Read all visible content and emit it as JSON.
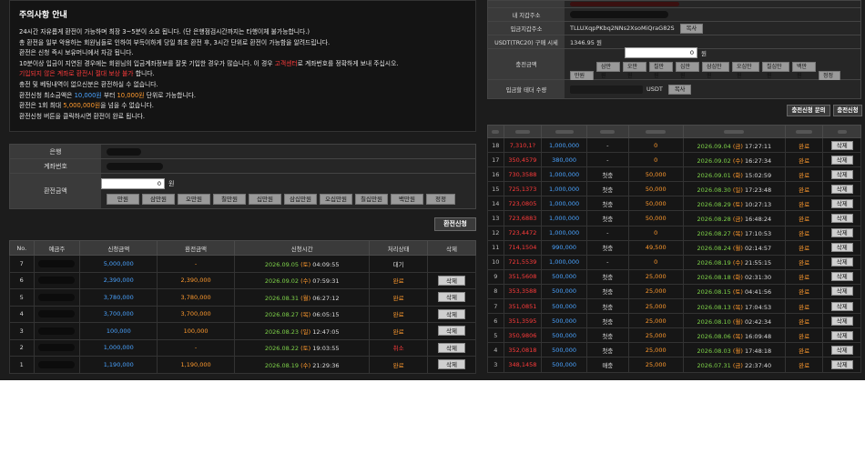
{
  "notice": {
    "title": "주의사항 안내",
    "lines": [
      {
        "text": "24시간 자유롭게 환전이 가능하며 최장 3~5분이 소요 됩니다. (단 은행점검시간까지는 타행이체 불가능합니다.)",
        "color": "default"
      },
      {
        "text": "총 환전을 일부 악용하는 회원님들로 인하여 부득이하게 당일 최초 환전 후, 3시간 단위로 환전이 가능함을 알려드립니다.",
        "color": "default"
      },
      {
        "text": "환전은 신청 즉시 보유머니에서 차감 됩니다.",
        "color": "default"
      },
      {
        "text": "10분이상 입금이 지연된 경우에는 회원님의 입금계좌정보를 잘못 기입한 경우가 많습니다. 이 경우 고객센터로 계좌번호를 정확하게 보내 주십시오.",
        "color": "mixed"
      },
      {
        "text": "기입되지 않은 계좌로 환전시 절대 보상 불가",
        "color": "red"
      },
      {
        "text": "충전 및 베팅내역이 없으신분은 환전하실 수 없습니다.",
        "color": "default"
      },
      {
        "text": "환전신청 최소금액은 10,000원 부터 10,000원 단위로 가능합니다.",
        "color": "mixed2"
      },
      {
        "text": "환전은 1회 최대 5,000,000원을 넘을 수 없습니다.",
        "color": "mixed3"
      },
      {
        "text": "환전신청 버튼을 클릭하시면 환전이 완료 됩니다.",
        "color": "default"
      }
    ],
    "line4_pre": "10분이상 입금이 지연된 경우에는 회원님의 입금계좌정보를 잘못 기입한 경우가 많습니다. 이 경우 ",
    "line4_red": "고객센터",
    "line4_post": "로 계좌번호를 정확하게 보내 주십시오.",
    "line7_pre": "환전신청 최소금액은 ",
    "line7_a": "10,000원",
    "line7_mid": " 부터 ",
    "line7_b": "10,000원",
    "line7_post": " 단위로 가능합니다.",
    "line8_pre": "환전은 1회 최대 ",
    "line8_a": "5,000,000원",
    "line8_post": "을 넘을 수 없습니다.",
    "line5_red": "기입되지 않은 계좌로 환전시 절대 보상 불가",
    "line5_post": " 합니다."
  },
  "withdraw_form": {
    "bank_label": "은행",
    "account_label": "계좌번호",
    "amount_label": "환전금액",
    "amount_value": "0",
    "unit": "원",
    "chips": [
      "만원",
      "삼만원",
      "오만원",
      "칠만원",
      "십만원",
      "삼십만원",
      "오십만원",
      "칠십만원",
      "백만원",
      "정정"
    ],
    "submit_label": "환전신청"
  },
  "withdraw_table": {
    "headers": [
      "No.",
      "예금주",
      "신청금액",
      "환전금액",
      "신청시간",
      "처리상태",
      "삭제"
    ],
    "rows": [
      {
        "no": "7",
        "amount": "5,000,000",
        "exchanged": "-",
        "date": "2026.09.05",
        "day": "(토)",
        "time": "04:09:55",
        "status": "대기",
        "status_color": "white",
        "del": ""
      },
      {
        "no": "6",
        "amount": "2,390,000",
        "exchanged": "2,390,000",
        "date": "2026.09.02",
        "day": "(수)",
        "time": "07:59:31",
        "status": "완료",
        "status_color": "orange",
        "del": "삭제"
      },
      {
        "no": "5",
        "amount": "3,780,000",
        "exchanged": "3,780,000",
        "date": "2026.08.31",
        "day": "(월)",
        "time": "06:27:12",
        "status": "완료",
        "status_color": "orange",
        "del": "삭제"
      },
      {
        "no": "4",
        "amount": "3,700,000",
        "exchanged": "3,700,000",
        "date": "2026.08.27",
        "day": "(목)",
        "time": "06:05:15",
        "status": "완료",
        "status_color": "orange",
        "del": "삭제"
      },
      {
        "no": "3",
        "amount": "100,000",
        "exchanged": "100,000",
        "date": "2026.08.23",
        "day": "(일)",
        "time": "12:47:05",
        "status": "완료",
        "status_color": "orange",
        "del": "삭제"
      },
      {
        "no": "2",
        "amount": "1,000,000",
        "exchanged": "-",
        "date": "2026.08.22",
        "day": "(토)",
        "time": "19:03:55",
        "status": "취소",
        "status_color": "red",
        "del": "삭제"
      },
      {
        "no": "1",
        "amount": "1,190,000",
        "exchanged": "1,190,000",
        "date": "2026.08.19",
        "day": "(수)",
        "time": "21:29:36",
        "status": "완료",
        "status_color": "orange",
        "del": "삭제"
      }
    ]
  },
  "deposit_form": {
    "rows": [
      {
        "label": "",
        "value": ""
      },
      {
        "label": "내 지갑주소",
        "value": ""
      },
      {
        "label": "입금지갑주소",
        "value": "TLLUXqpPKbq2NNs2XsoMiQraG82S",
        "copy": "복사"
      },
      {
        "label": "USDT(TRC20) 구매 시세",
        "value": "1346.95 원"
      }
    ],
    "amount_label": "충전금액",
    "amount_value": "0",
    "unit": "원",
    "chips": [
      "만원",
      "삼만원",
      "오만원",
      "칠만원",
      "십만원",
      "삼십만원",
      "오십만원",
      "칠십만원",
      "백만원",
      "정정"
    ],
    "usdt_label": "입금할 테더 수량",
    "usdt_unit": "USDT",
    "usdt_copy": "복사",
    "btn_apply": "충전신청 문의",
    "btn_submit": "충전신청"
  },
  "deposit_table": {
    "headers": [
      "",
      "",
      "",
      "",
      "",
      "",
      "",
      ""
    ],
    "rows": [
      {
        "no": "18",
        "val": "7,310,1?",
        "amount": "1,000,000",
        "event": "-",
        "bonus": "0",
        "date": "2026.09.04",
        "day": "(금)",
        "time": "17:27:11",
        "status": "완료",
        "del": "삭제"
      },
      {
        "no": "17",
        "val": "350,4579",
        "amount": "380,000",
        "event": "-",
        "bonus": "0",
        "date": "2026.09.02",
        "day": "(수)",
        "time": "16:27:34",
        "status": "완료",
        "del": "삭제"
      },
      {
        "no": "16",
        "val": "730,3588",
        "amount": "1,000,000",
        "event": "첫충",
        "bonus": "50,000",
        "date": "2026.09.01",
        "day": "(화)",
        "time": "15:02:59",
        "status": "완료",
        "del": "삭제"
      },
      {
        "no": "15",
        "val": "725,1373",
        "amount": "1,000,000",
        "event": "첫충",
        "bonus": "50,000",
        "date": "2026.08.30",
        "day": "(일)",
        "time": "17:23:48",
        "status": "완료",
        "del": "삭제"
      },
      {
        "no": "14",
        "val": "723,0805",
        "amount": "1,000,000",
        "event": "첫충",
        "bonus": "50,000",
        "date": "2026.08.29",
        "day": "(토)",
        "time": "10:27:13",
        "status": "완료",
        "del": "삭제"
      },
      {
        "no": "13",
        "val": "723,6883",
        "amount": "1,000,000",
        "event": "첫충",
        "bonus": "50,000",
        "date": "2026.08.28",
        "day": "(금)",
        "time": "16:48:24",
        "status": "완료",
        "del": "삭제"
      },
      {
        "no": "12",
        "val": "723,4472",
        "amount": "1,000,000",
        "event": "-",
        "bonus": "0",
        "date": "2026.08.27",
        "day": "(목)",
        "time": "17:10:53",
        "status": "완료",
        "del": "삭제"
      },
      {
        "no": "11",
        "val": "714,1504",
        "amount": "990,000",
        "event": "첫충",
        "bonus": "49,500",
        "date": "2026.08.24",
        "day": "(월)",
        "time": "02:14:57",
        "status": "완료",
        "del": "삭제"
      },
      {
        "no": "10",
        "val": "721,5539",
        "amount": "1,000,000",
        "event": "-",
        "bonus": "0",
        "date": "2026.08.19",
        "day": "(수)",
        "time": "21:55:15",
        "status": "완료",
        "del": "삭제"
      },
      {
        "no": "9",
        "val": "351,5608",
        "amount": "500,000",
        "event": "첫충",
        "bonus": "25,000",
        "date": "2026.08.18",
        "day": "(화)",
        "time": "02:31:30",
        "status": "완료",
        "del": "삭제"
      },
      {
        "no": "8",
        "val": "353,3588",
        "amount": "500,000",
        "event": "첫충",
        "bonus": "25,000",
        "date": "2026.08.15",
        "day": "(토)",
        "time": "04:41:56",
        "status": "완료",
        "del": "삭제"
      },
      {
        "no": "7",
        "val": "351,0851",
        "amount": "500,000",
        "event": "첫충",
        "bonus": "25,000",
        "date": "2026.08.13",
        "day": "(목)",
        "time": "17:04:53",
        "status": "완료",
        "del": "삭제"
      },
      {
        "no": "6",
        "val": "351,3595",
        "amount": "500,000",
        "event": "첫충",
        "bonus": "25,000",
        "date": "2026.08.10",
        "day": "(월)",
        "time": "02:42:34",
        "status": "완료",
        "del": "삭제"
      },
      {
        "no": "5",
        "val": "350,9806",
        "amount": "500,000",
        "event": "첫충",
        "bonus": "25,000",
        "date": "2026.08.06",
        "day": "(목)",
        "time": "16:09:48",
        "status": "완료",
        "del": "삭제"
      },
      {
        "no": "4",
        "val": "352,0818",
        "amount": "500,000",
        "event": "첫충",
        "bonus": "25,000",
        "date": "2026.08.03",
        "day": "(월)",
        "time": "17:48:18",
        "status": "완료",
        "del": "삭제"
      },
      {
        "no": "3",
        "val": "348,1458",
        "amount": "500,000",
        "event": "매충",
        "bonus": "25,000",
        "date": "2026.07.31",
        "day": "(금)",
        "time": "22:37:40",
        "status": "완료",
        "del": "삭제"
      }
    ]
  }
}
